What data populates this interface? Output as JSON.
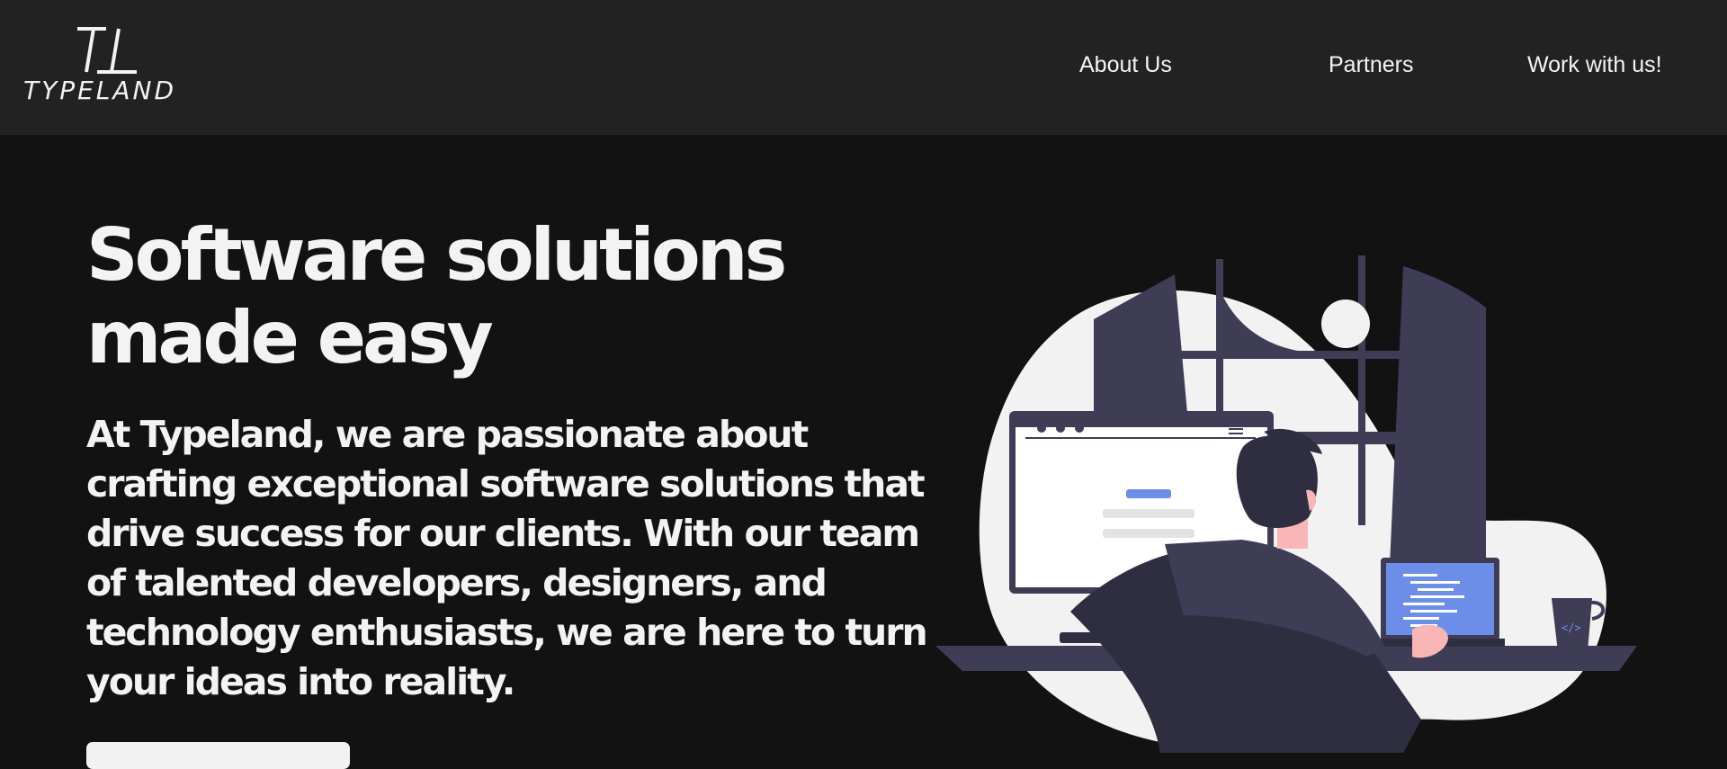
{
  "header": {
    "logo_mark": "TL",
    "logo_text": "TYPELAND"
  },
  "nav": {
    "about": "About Us",
    "partners": "Partners",
    "work": "Work with us!"
  },
  "hero": {
    "title_line1": "Software solutions",
    "title_line2": "made easy",
    "description": "At Typeland, we are passionate about crafting exceptional software solutions that drive success for our clients. With our team of talented developers, designers, and technology enthusiasts, we are here to turn your ideas into reality.",
    "cta_label": ""
  },
  "colors": {
    "header_bg": "#222223",
    "page_bg": "#121213",
    "text": "#f2f2f2",
    "illustration_dark": "#3f3d56",
    "illustration_accent": "#6c8ee8",
    "illustration_light": "#f2f2f2",
    "skin": "#f8b6b6"
  },
  "illustration": {
    "subject": "developer-at-desk",
    "icon_name": "developer-workspace-illustration"
  }
}
